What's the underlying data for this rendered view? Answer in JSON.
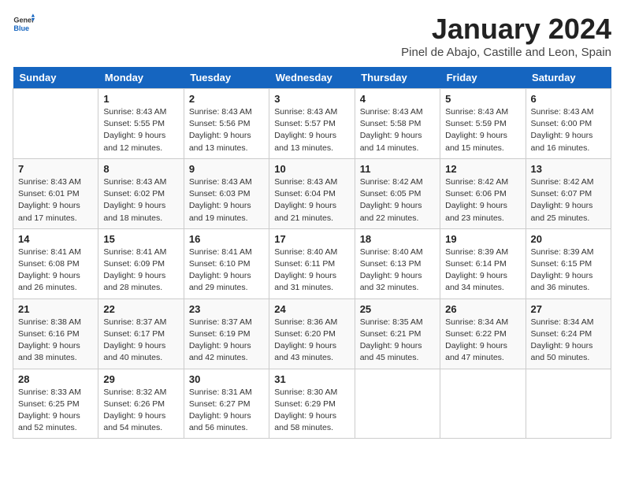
{
  "header": {
    "logo_general": "General",
    "logo_blue": "Blue",
    "title": "January 2024",
    "subtitle": "Pinel de Abajo, Castille and Leon, Spain"
  },
  "columns": [
    "Sunday",
    "Monday",
    "Tuesday",
    "Wednesday",
    "Thursday",
    "Friday",
    "Saturday"
  ],
  "weeks": [
    [
      {
        "day": "",
        "text": ""
      },
      {
        "day": "1",
        "text": "Sunrise: 8:43 AM\nSunset: 5:55 PM\nDaylight: 9 hours\nand 12 minutes."
      },
      {
        "day": "2",
        "text": "Sunrise: 8:43 AM\nSunset: 5:56 PM\nDaylight: 9 hours\nand 13 minutes."
      },
      {
        "day": "3",
        "text": "Sunrise: 8:43 AM\nSunset: 5:57 PM\nDaylight: 9 hours\nand 13 minutes."
      },
      {
        "day": "4",
        "text": "Sunrise: 8:43 AM\nSunset: 5:58 PM\nDaylight: 9 hours\nand 14 minutes."
      },
      {
        "day": "5",
        "text": "Sunrise: 8:43 AM\nSunset: 5:59 PM\nDaylight: 9 hours\nand 15 minutes."
      },
      {
        "day": "6",
        "text": "Sunrise: 8:43 AM\nSunset: 6:00 PM\nDaylight: 9 hours\nand 16 minutes."
      }
    ],
    [
      {
        "day": "7",
        "text": "Sunrise: 8:43 AM\nSunset: 6:01 PM\nDaylight: 9 hours\nand 17 minutes."
      },
      {
        "day": "8",
        "text": "Sunrise: 8:43 AM\nSunset: 6:02 PM\nDaylight: 9 hours\nand 18 minutes."
      },
      {
        "day": "9",
        "text": "Sunrise: 8:43 AM\nSunset: 6:03 PM\nDaylight: 9 hours\nand 19 minutes."
      },
      {
        "day": "10",
        "text": "Sunrise: 8:43 AM\nSunset: 6:04 PM\nDaylight: 9 hours\nand 21 minutes."
      },
      {
        "day": "11",
        "text": "Sunrise: 8:42 AM\nSunset: 6:05 PM\nDaylight: 9 hours\nand 22 minutes."
      },
      {
        "day": "12",
        "text": "Sunrise: 8:42 AM\nSunset: 6:06 PM\nDaylight: 9 hours\nand 23 minutes."
      },
      {
        "day": "13",
        "text": "Sunrise: 8:42 AM\nSunset: 6:07 PM\nDaylight: 9 hours\nand 25 minutes."
      }
    ],
    [
      {
        "day": "14",
        "text": "Sunrise: 8:41 AM\nSunset: 6:08 PM\nDaylight: 9 hours\nand 26 minutes."
      },
      {
        "day": "15",
        "text": "Sunrise: 8:41 AM\nSunset: 6:09 PM\nDaylight: 9 hours\nand 28 minutes."
      },
      {
        "day": "16",
        "text": "Sunrise: 8:41 AM\nSunset: 6:10 PM\nDaylight: 9 hours\nand 29 minutes."
      },
      {
        "day": "17",
        "text": "Sunrise: 8:40 AM\nSunset: 6:11 PM\nDaylight: 9 hours\nand 31 minutes."
      },
      {
        "day": "18",
        "text": "Sunrise: 8:40 AM\nSunset: 6:13 PM\nDaylight: 9 hours\nand 32 minutes."
      },
      {
        "day": "19",
        "text": "Sunrise: 8:39 AM\nSunset: 6:14 PM\nDaylight: 9 hours\nand 34 minutes."
      },
      {
        "day": "20",
        "text": "Sunrise: 8:39 AM\nSunset: 6:15 PM\nDaylight: 9 hours\nand 36 minutes."
      }
    ],
    [
      {
        "day": "21",
        "text": "Sunrise: 8:38 AM\nSunset: 6:16 PM\nDaylight: 9 hours\nand 38 minutes."
      },
      {
        "day": "22",
        "text": "Sunrise: 8:37 AM\nSunset: 6:17 PM\nDaylight: 9 hours\nand 40 minutes."
      },
      {
        "day": "23",
        "text": "Sunrise: 8:37 AM\nSunset: 6:19 PM\nDaylight: 9 hours\nand 42 minutes."
      },
      {
        "day": "24",
        "text": "Sunrise: 8:36 AM\nSunset: 6:20 PM\nDaylight: 9 hours\nand 43 minutes."
      },
      {
        "day": "25",
        "text": "Sunrise: 8:35 AM\nSunset: 6:21 PM\nDaylight: 9 hours\nand 45 minutes."
      },
      {
        "day": "26",
        "text": "Sunrise: 8:34 AM\nSunset: 6:22 PM\nDaylight: 9 hours\nand 47 minutes."
      },
      {
        "day": "27",
        "text": "Sunrise: 8:34 AM\nSunset: 6:24 PM\nDaylight: 9 hours\nand 50 minutes."
      }
    ],
    [
      {
        "day": "28",
        "text": "Sunrise: 8:33 AM\nSunset: 6:25 PM\nDaylight: 9 hours\nand 52 minutes."
      },
      {
        "day": "29",
        "text": "Sunrise: 8:32 AM\nSunset: 6:26 PM\nDaylight: 9 hours\nand 54 minutes."
      },
      {
        "day": "30",
        "text": "Sunrise: 8:31 AM\nSunset: 6:27 PM\nDaylight: 9 hours\nand 56 minutes."
      },
      {
        "day": "31",
        "text": "Sunrise: 8:30 AM\nSunset: 6:29 PM\nDaylight: 9 hours\nand 58 minutes."
      },
      {
        "day": "",
        "text": ""
      },
      {
        "day": "",
        "text": ""
      },
      {
        "day": "",
        "text": ""
      }
    ]
  ]
}
